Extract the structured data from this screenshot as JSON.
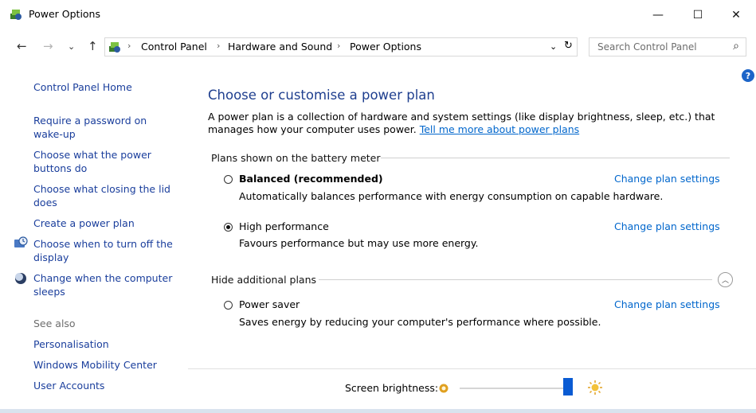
{
  "window": {
    "title": "Power Options",
    "icon": "power-options-icon"
  },
  "window_controls": {
    "minimize": "—",
    "maximize": "☐",
    "close": "✕"
  },
  "nav": {
    "back": "←",
    "forward": "→",
    "recent": "⌄",
    "up": "↑",
    "breadcrumbs": [
      "Control Panel",
      "Hardware and Sound",
      "Power Options"
    ],
    "separator": "›",
    "dropdown": "⌄",
    "refresh": "↻"
  },
  "search": {
    "placeholder": "Search Control Panel",
    "icon": "⌕"
  },
  "sidebar": {
    "home": "Control Panel Home",
    "items": [
      "Require a password on wake-up",
      "Choose what the power buttons do",
      "Choose what closing the lid does",
      "Create a power plan",
      "Choose when to turn off the display",
      "Change when the computer sleeps"
    ],
    "see_also_label": "See also",
    "see_also": [
      "Personalisation",
      "Windows Mobility Center",
      "User Accounts"
    ]
  },
  "main": {
    "title": "Choose or customise a power plan",
    "intro": "A power plan is a collection of hardware and system settings (like display brightness, sleep, etc.) that manages how your computer uses power.",
    "intro_link": "Tell me more about power plans",
    "section_battery": "Plans shown on the battery meter",
    "section_hidden": "Hide additional plans",
    "change_label": "Change plan settings",
    "plans": [
      {
        "name": "Balanced (recommended)",
        "desc": "Automatically balances performance with energy consumption on capable hardware.",
        "selected": false
      },
      {
        "name": "High performance",
        "desc": "Favours performance but may use more energy.",
        "selected": true
      },
      {
        "name": "Power saver",
        "desc": "Saves energy by reducing your computer's performance where possible.",
        "selected": false
      }
    ],
    "help": "?"
  },
  "brightness": {
    "label": "Screen brightness:",
    "level_percent": 97
  },
  "colors": {
    "link": "#0066cc",
    "heading": "#1f3f8f",
    "slider": "#0a5bd3"
  }
}
